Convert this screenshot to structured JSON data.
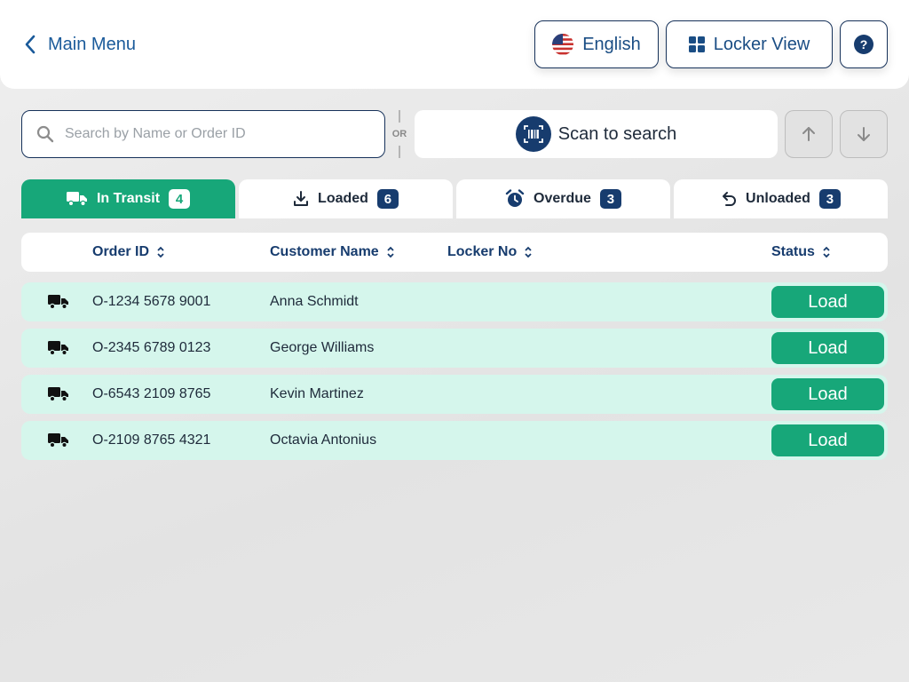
{
  "header": {
    "back_label": "Main Menu",
    "language_label": "English",
    "locker_view_label": "Locker View",
    "help_label": "?"
  },
  "search": {
    "placeholder": "Search by Name or Order ID",
    "or_label": "OR",
    "scan_label": "Scan to search"
  },
  "tabs": [
    {
      "label": "In Transit",
      "count": "4",
      "icon": "truck-icon",
      "active": true
    },
    {
      "label": "Loaded",
      "count": "6",
      "icon": "download-icon",
      "active": false
    },
    {
      "label": "Overdue",
      "count": "3",
      "icon": "alarm-clock-icon",
      "active": false
    },
    {
      "label": "Unloaded",
      "count": "3",
      "icon": "undo-arrow-icon",
      "active": false
    }
  ],
  "table": {
    "columns": [
      "Order ID",
      "Customer Name",
      "Locker No",
      "Status"
    ],
    "rows": [
      {
        "order_id": "O-1234 5678 9001",
        "customer": "Anna Schmidt",
        "locker": "",
        "action": "Load"
      },
      {
        "order_id": "O-2345 6789 0123",
        "customer": "George Williams",
        "locker": "",
        "action": "Load"
      },
      {
        "order_id": "O-6543 2109 8765",
        "customer": "Kevin Martinez",
        "locker": "",
        "action": "Load"
      },
      {
        "order_id": "O-2109 8765 4321",
        "customer": "Octavia Antonius",
        "locker": "",
        "action": "Load"
      }
    ]
  },
  "colors": {
    "accent_green": "#17a779",
    "navy": "#173c6e",
    "row_bg": "#d5f6ec"
  }
}
